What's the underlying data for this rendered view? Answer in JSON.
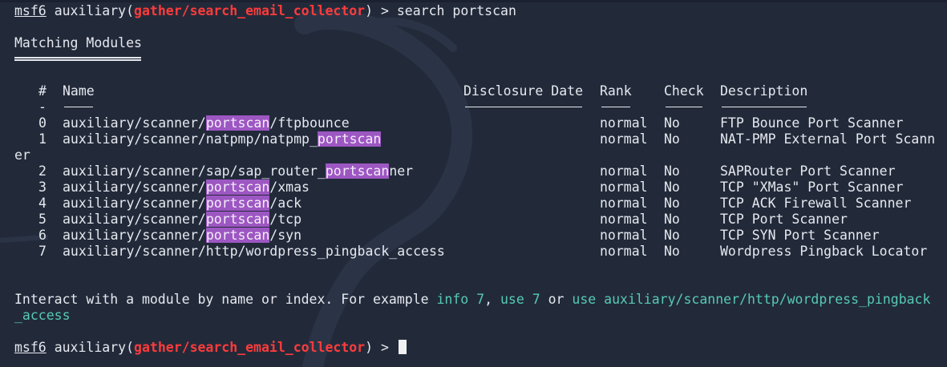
{
  "prompt1": {
    "name": "msf6",
    "module_word": "auxiliary(",
    "module_path": "gather/search_email_collector",
    "close": ") > ",
    "command": "search portscan"
  },
  "title": "Matching Modules",
  "headers": {
    "num": "#",
    "name": "Name",
    "date": "Disclosure Date",
    "rank": "Rank",
    "check": "Check",
    "desc": "Description"
  },
  "dash_num": "-",
  "rows": [
    {
      "num": "0",
      "pre": "auxiliary/scanner/",
      "hl": "portscan",
      "post": "/ftpbounce",
      "rank": "normal",
      "check": "No",
      "desc": "FTP Bounce Port Scanner"
    },
    {
      "num": "1",
      "pre": "auxiliary/scanner/natpmp/natpmp_",
      "hl": "portscan",
      "post": "",
      "rank": "normal",
      "check": "No",
      "desc": "NAT-PMP External Port Scann",
      "wrap": "er"
    },
    {
      "num": "2",
      "pre": "auxiliary/scanner/sap/sap_router_",
      "hl": "portscan",
      "post": "ner",
      "rank": "normal",
      "check": "No",
      "desc": "SAPRouter Port Scanner"
    },
    {
      "num": "3",
      "pre": "auxiliary/scanner/",
      "hl": "portscan",
      "post": "/xmas",
      "rank": "normal",
      "check": "No",
      "desc": "TCP \"XMas\" Port Scanner"
    },
    {
      "num": "4",
      "pre": "auxiliary/scanner/",
      "hl": "portscan",
      "post": "/ack",
      "rank": "normal",
      "check": "No",
      "desc": "TCP ACK Firewall Scanner"
    },
    {
      "num": "5",
      "pre": "auxiliary/scanner/",
      "hl": "portscan",
      "post": "/tcp",
      "rank": "normal",
      "check": "No",
      "desc": "TCP Port Scanner"
    },
    {
      "num": "6",
      "pre": "auxiliary/scanner/",
      "hl": "portscan",
      "post": "/syn",
      "rank": "normal",
      "check": "No",
      "desc": "TCP SYN Port Scanner"
    },
    {
      "num": "7",
      "pre": "auxiliary/scanner/http/wordpress_pingback_access",
      "hl": "",
      "post": "",
      "rank": "normal",
      "check": "No",
      "desc": "Wordpress Pingback Locator"
    }
  ],
  "interact": {
    "text": "Interact with a module by name or index. For example ",
    "info": "info 7",
    "comma": ", ",
    "use": "use 7",
    "or": " or ",
    "use_full_1": "use auxiliary/scanner/http/wordpress_pingback",
    "use_full_2": "_access"
  },
  "prompt2": {
    "name": "msf6",
    "module_word": "auxiliary(",
    "module_path": "gather/search_email_collector",
    "close": ") > "
  },
  "colors": {
    "background": "#222a3a",
    "text": "#e6e8ee",
    "module_red": "#ff3b3b",
    "highlight": "#9d57c2",
    "teal": "#57c9b4"
  }
}
